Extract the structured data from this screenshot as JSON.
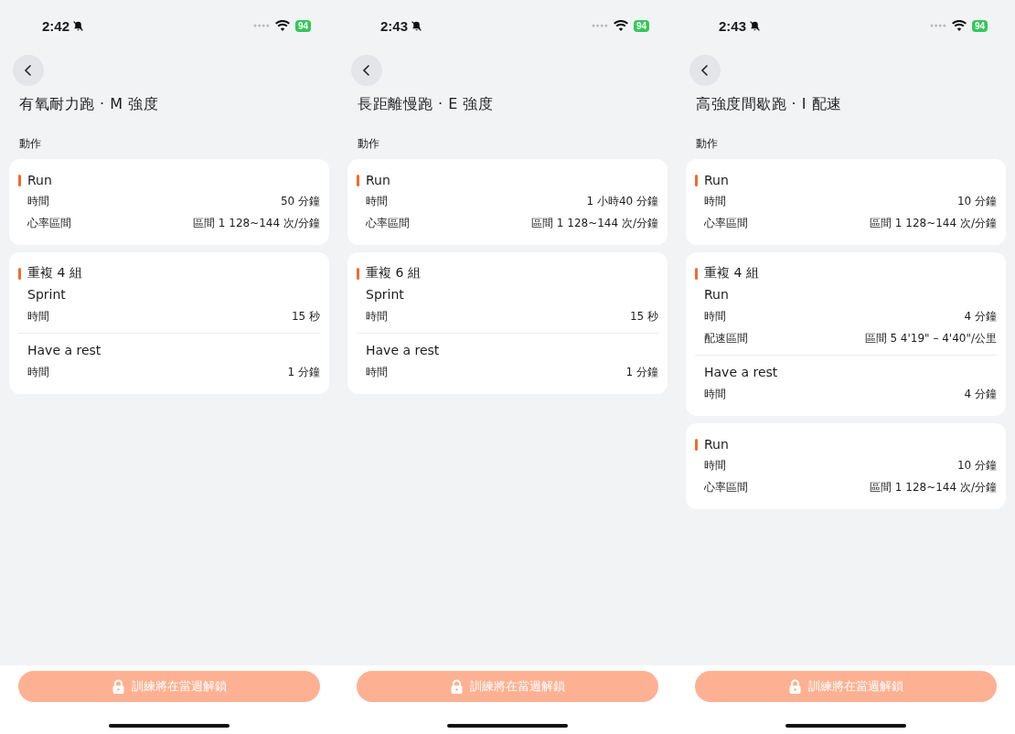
{
  "screens": [
    {
      "status_bar": {
        "time": "2:42",
        "battery": "94"
      },
      "title": "有氧耐力跑 · M 強度",
      "section_label": "動作",
      "cards": [
        {
          "kind": "step",
          "name": "Run",
          "rows": [
            {
              "label": "時間",
              "value": "50 分鐘"
            },
            {
              "label": "心率區間",
              "value": "區間 1 128~144 次/分鐘"
            }
          ]
        },
        {
          "kind": "repeat",
          "name": "重複 4 組",
          "steps": [
            {
              "name": "Sprint",
              "rows": [
                {
                  "label": "時間",
                  "value": "15 秒"
                }
              ]
            },
            {
              "name": "Have a rest",
              "rows": [
                {
                  "label": "時間",
                  "value": "1 分鐘"
                }
              ]
            }
          ]
        }
      ],
      "unlock_button": {
        "label": "訓練將在當週解鎖",
        "disabled": true
      }
    },
    {
      "status_bar": {
        "time": "2:43",
        "battery": "94"
      },
      "title": "長距離慢跑 · E 強度",
      "section_label": "動作",
      "cards": [
        {
          "kind": "step",
          "name": "Run",
          "rows": [
            {
              "label": "時間",
              "value": "1 小時40 分鐘"
            },
            {
              "label": "心率區間",
              "value": "區間 1 128~144 次/分鐘"
            }
          ]
        },
        {
          "kind": "repeat",
          "name": "重複 6 組",
          "steps": [
            {
              "name": "Sprint",
              "rows": [
                {
                  "label": "時間",
                  "value": "15 秒"
                }
              ]
            },
            {
              "name": "Have a rest",
              "rows": [
                {
                  "label": "時間",
                  "value": "1 分鐘"
                }
              ]
            }
          ]
        }
      ],
      "unlock_button": {
        "label": "訓練將在當週解鎖",
        "disabled": true
      }
    },
    {
      "status_bar": {
        "time": "2:43",
        "battery": "94"
      },
      "title": "高強度間歇跑 · I 配速",
      "section_label": "動作",
      "cards": [
        {
          "kind": "step",
          "name": "Run",
          "rows": [
            {
              "label": "時間",
              "value": "10 分鐘"
            },
            {
              "label": "心率區間",
              "value": "區間 1 128~144 次/分鐘"
            }
          ]
        },
        {
          "kind": "repeat",
          "name": "重複 4 組",
          "steps": [
            {
              "name": "Run",
              "rows": [
                {
                  "label": "時間",
                  "value": "4 分鐘"
                },
                {
                  "label": "配速區間",
                  "value": "區間 5 4'19\" – 4'40\"/公里"
                }
              ]
            },
            {
              "name": "Have a rest",
              "rows": [
                {
                  "label": "時間",
                  "value": "4 分鐘"
                }
              ]
            }
          ]
        },
        {
          "kind": "step",
          "name": "Run",
          "rows": [
            {
              "label": "時間",
              "value": "10 分鐘"
            },
            {
              "label": "心率區間",
              "value": "區間 1 128~144 次/分鐘"
            }
          ]
        }
      ],
      "unlock_button": {
        "label": "訓練將在當週解鎖",
        "disabled": true
      }
    }
  ]
}
